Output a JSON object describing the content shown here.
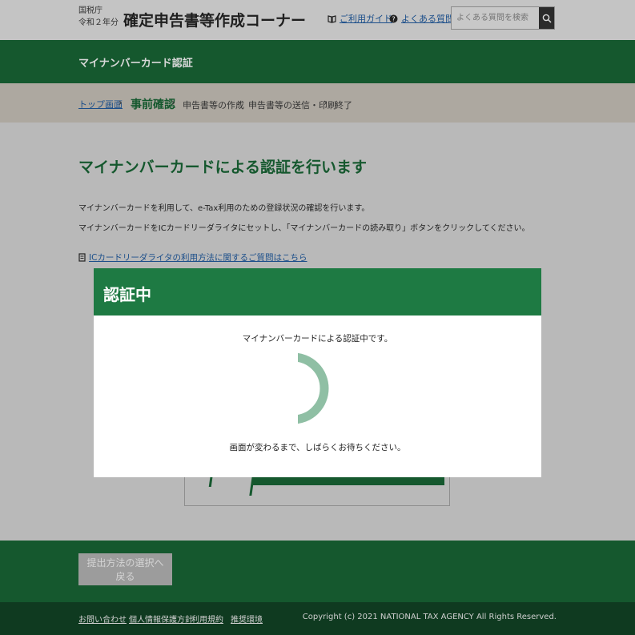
{
  "header": {
    "agency_line1": "国税庁",
    "agency_line2": "令和２年分",
    "site_title": "確定申告書等作成コーナー",
    "guide_link": "ご利用ガイド",
    "faq_link": "よくある質問",
    "search_placeholder": "よくある質問を検索",
    "search_icon": "search-icon"
  },
  "section_bar": {
    "title": "マイナンバーカード認証"
  },
  "breadcrumb": {
    "items": [
      "トップ画面",
      "事前確認",
      "申告書等の作成",
      "申告書等の送信・印刷",
      "終了"
    ],
    "separator": "›"
  },
  "main": {
    "title": "マイナンバーカードによる認証を行います",
    "para1": "マイナンバーカードを利用して、e-Tax利用のための登録状況の確認を行います。",
    "para2": "マイナンバーカードをICカードリーダライタにセットし、「マイナンバーカードの読み取り」ボタンをクリックしてください。",
    "help_link": "ICカードリーダライタの利用方法に関するご質問はこちら"
  },
  "modal": {
    "title": "認証中",
    "message": "マイナンバーカードによる認証中です。",
    "wait_message": "画面が変わるまで、しばらくお待ちください。",
    "spinner_color": "#8fbfa4"
  },
  "footer": {
    "back_button": "提出方法の選択へ戻る",
    "links": [
      "お問い合わせ",
      "個人情報保護方針",
      "利用規約",
      "推奨環境"
    ],
    "copyright": "Copyright (c) 2021 NATIONAL TAX AGENCY All Rights Reserved."
  },
  "colors": {
    "brand_green": "#15582e",
    "modal_green": "#1e7a43",
    "link_blue": "#1b4e8a"
  }
}
